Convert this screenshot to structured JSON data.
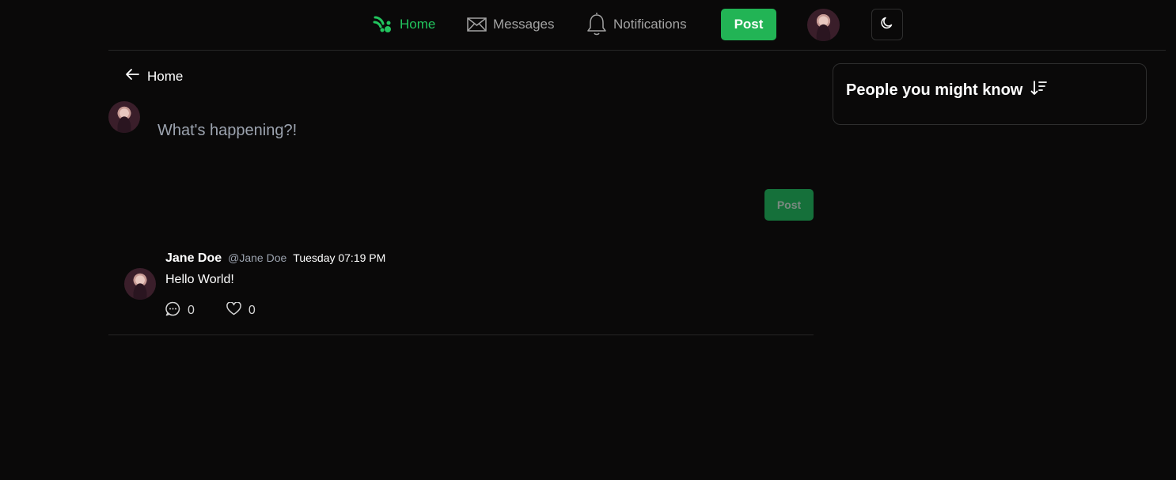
{
  "nav": {
    "home_label": "Home",
    "messages_label": "Messages",
    "notifications_label": "Notifications",
    "post_label": "Post"
  },
  "back": {
    "label": "Home"
  },
  "compose": {
    "placeholder": "What's happening?!",
    "post_label": "Post"
  },
  "feed": {
    "posts": [
      {
        "name": "Jane Doe",
        "handle": "@Jane Doe",
        "time": "Tuesday 07:19 PM",
        "body": "Hello World!",
        "comments": "0",
        "likes": "0"
      }
    ]
  },
  "sidebar": {
    "title": "People you might know"
  },
  "colors": {
    "accent": "#22c55e",
    "background": "#0a0909",
    "border": "#262626"
  }
}
